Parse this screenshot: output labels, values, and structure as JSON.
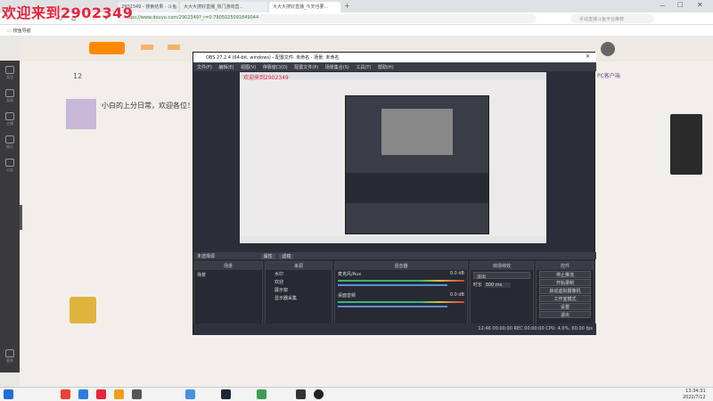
{
  "watermark": "欢迎来到2902349",
  "browser": {
    "tabs": [
      "2902349 - 搜索结果 - 斗鱼…",
      "大大大搜好直播_热门游戏直…",
      "大大大搜好直播_今天也要…"
    ],
    "url": "https://www.douyu.com/2902349?_r=0.7905025091849044",
    "search_placeholder": "手动直播斗鱼平台推荐",
    "bookmark": "搜鱼导航"
  },
  "rail": [
    "关注",
    "发现",
    "主播",
    "娱乐",
    "公告",
    "更多"
  ],
  "obs": {
    "title": "OBS 27.2.4 (64-bit, windows) - 配置文件: 未命名 - 场景: 未命名",
    "menu": "文件(F) 编辑(E) 视图(V) 停靠窗口(D) 配置文件(P) 场景集合(S) 工具(T) 帮助(H)",
    "no_source": "未选择源",
    "props": "属性",
    "filters": "滤镜",
    "docks": {
      "scenes": "场景",
      "sources": "来源",
      "mixer": "混音器",
      "transitions": "转场特效",
      "controls": "控件"
    },
    "scene_items": [
      "场景"
    ],
    "source_items": [
      "水印",
      "欢迎",
      "展示窗",
      "显示器采集"
    ],
    "mixer": [
      {
        "name": "麦克风/Aux",
        "db": "0.0 dB"
      },
      {
        "name": "桌面音频",
        "db": "0.0 dB"
      }
    ],
    "transition": {
      "type": "淡出",
      "duration_label": "时长",
      "duration": "300 ms"
    },
    "controls": [
      "停止推流",
      "开始录制",
      "启动虚拟摄像机",
      "工作室模式",
      "设置",
      "退出"
    ],
    "status": "12:46  00:00:00   REC  00:00:00   CPU: 4.0%, 60.00 fps"
  },
  "stream": {
    "title": "小白的上分日常，欢迎各位！",
    "count": "12",
    "right_label": "PC客户端"
  },
  "taskbar": {
    "time": "13:34:31",
    "date": "2022/7/12"
  }
}
